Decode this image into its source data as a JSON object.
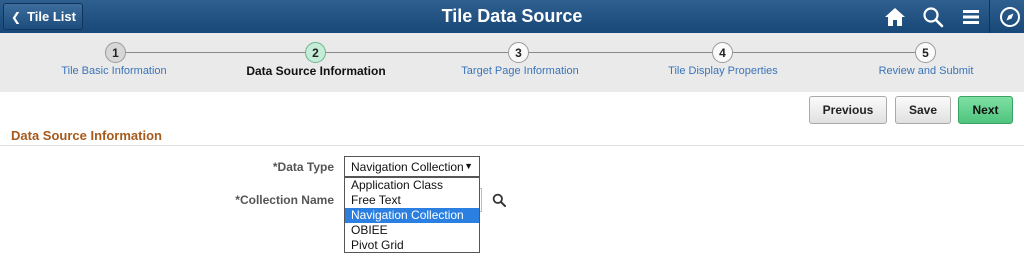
{
  "header": {
    "back_label": "Tile List",
    "title": "Tile Data Source",
    "icons": [
      "home-icon",
      "search-icon",
      "menu-icon",
      "navbar-compass-icon"
    ]
  },
  "train": {
    "steps": [
      {
        "number": "1",
        "label": "Tile Basic Information",
        "state": "done"
      },
      {
        "number": "2",
        "label": "Data Source Information",
        "state": "active"
      },
      {
        "number": "3",
        "label": "Target Page Information",
        "state": "pending"
      },
      {
        "number": "4",
        "label": "Tile Display Properties",
        "state": "pending"
      },
      {
        "number": "5",
        "label": "Review and Submit",
        "state": "pending"
      }
    ]
  },
  "actions": {
    "previous_label": "Previous",
    "save_label": "Save",
    "next_label": "Next"
  },
  "section": {
    "title": "Data Source Information"
  },
  "form": {
    "data_type_label": "*Data Type",
    "data_type_value": "Navigation Collection",
    "collection_name_label": "*Collection Name",
    "collection_name_value": "",
    "data_type_options": [
      "Application Class",
      "Free Text",
      "Navigation Collection",
      "OBIEE",
      "Pivot Grid"
    ],
    "selected_option_index": 2
  },
  "colors": {
    "header_bg": "#1f4f7f",
    "section_title": "#a65a1c",
    "link": "#3a74b8",
    "active_step": "#c4ecd6",
    "next_button": "#5fcf8c",
    "selected_option": "#2a7fe0"
  }
}
